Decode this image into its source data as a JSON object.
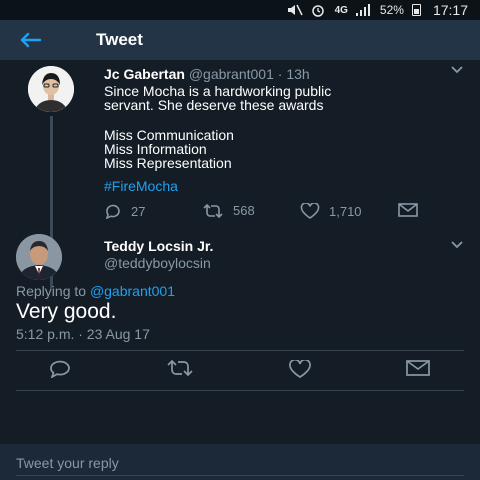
{
  "status_bar": {
    "network": "4G",
    "battery": "52%",
    "time": "17:17"
  },
  "header": {
    "title": "Tweet"
  },
  "tweet": {
    "name": "Jc Gabertan",
    "handle_time": "@gabrant001 · 13h",
    "lines": [
      "Since Mocha is a hardworking public",
      "servant. She deserve these awards",
      "",
      "Miss Communication",
      "Miss Information",
      "Miss Representation"
    ],
    "hashtag": "#FireMocha",
    "replies": "27",
    "retweets": "568",
    "likes": "1,710"
  },
  "reply": {
    "name": "Teddy Locsin Jr.",
    "handle": "@teddyboylocsin",
    "replying_prefix": "Replying to",
    "replying_to": "@gabrant001",
    "text": "Very good.",
    "timestamp": "5:12 p.m. · 23 Aug 17"
  },
  "compose": {
    "placeholder": "Tweet your reply"
  },
  "colors": {
    "background": "#141d26",
    "header": "#243447",
    "accent": "#1da1f2",
    "secondary_text": "#8899a6"
  }
}
